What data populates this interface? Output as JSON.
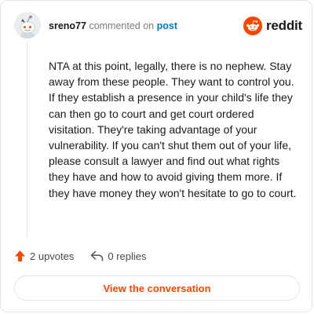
{
  "header": {
    "username": "sreno77",
    "action_text": "commented on",
    "post_link": "post"
  },
  "brand": {
    "logo_text": "reddit",
    "logo_icon": "reddit-snoo-icon",
    "accent_color": "#ff4500"
  },
  "comment": {
    "body": "NTA at this point, legally, there is no nephew. Stay away from these people. They want to control you. If they establish a presence in your child's life they can then go to court and get court ordered visitation. They're taking advantage of your vulnerability. If you can't shut them out of your life, please consult a lawyer and find out what rights they have and how to avoid giving them more. If they have money they won't hesitate to go to court."
  },
  "actions": {
    "upvotes_label": "2 upvotes",
    "upvote_icon": "upvote-arrow-icon",
    "replies_label": "0 replies",
    "reply_icon": "reply-arrow-icon"
  },
  "cta": {
    "label": "View the conversation"
  }
}
